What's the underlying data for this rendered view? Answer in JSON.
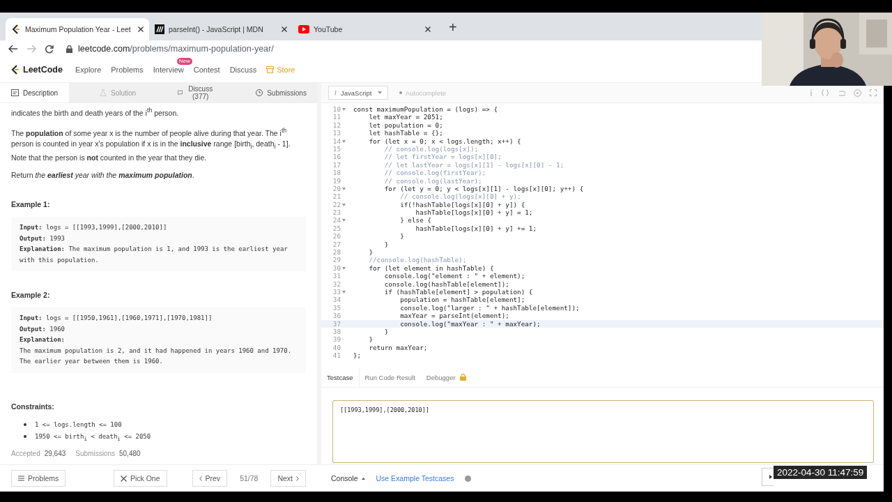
{
  "browser": {
    "tabs": [
      {
        "title": "Maximum Population Year - Leet",
        "selected": true
      },
      {
        "title": "parseInt() - JavaScript | MDN",
        "selected": false
      },
      {
        "title": "YouTube",
        "selected": false
      }
    ],
    "new_tab": "+",
    "url_host": "leetcode.com",
    "url_path": "/problems/maximum-population-year/"
  },
  "nav": {
    "brand": "LeetCode",
    "items": [
      {
        "label": "Explore"
      },
      {
        "label": "Problems"
      },
      {
        "label": "Interview",
        "badge": "New"
      },
      {
        "label": "Contest"
      },
      {
        "label": "Discuss"
      },
      {
        "label": "Store",
        "kind": "store"
      }
    ]
  },
  "left_tabs": [
    {
      "label": "Description",
      "selected": true,
      "disabled": false
    },
    {
      "label": "Solution",
      "selected": false,
      "disabled": true
    },
    {
      "label": "Discuss (377)",
      "selected": false,
      "disabled": false
    },
    {
      "label": "Submissions",
      "selected": false,
      "disabled": false
    }
  ],
  "description": [
    "indicates the birth and death years of the i$^{th}$ person.",
    "The **population** of some year x is the number of people alive during that year. The i$^{th}$ person is counted in year x's population if x is in the **inclusive** range [birth$_{i}$, death$_{i}$ - 1]. Note that the person is **not** counted in the year that they die.",
    "Return *the* **earliest** *year with the* **maximum population**."
  ],
  "examples": [
    {
      "title": "Example 1:",
      "lines": [
        "**Input:** logs = [[1993,1999],[2000,2010]]",
        "**Output:** 1993",
        "**Explanation:** The maximum population is 1, and 1993 is the earliest year with this population."
      ]
    },
    {
      "title": "Example 2:",
      "lines": [
        "**Input:** logs = [[1950,1961],[1960,1971],[1970,1981]]",
        "**Output:** 1960",
        "**Explanation:**",
        "The maximum population is 2, and it had happened in years 1960 and 1970.",
        "The earlier year between them is 1960."
      ]
    }
  ],
  "constraints": {
    "title": "Constraints:",
    "items": [
      "1 <= logs.length <= 100",
      "1950 <= birth$_{i}$ < death$_{i}$ <= 2050"
    ]
  },
  "stats": [
    {
      "label": "Accepted",
      "value": "29,643"
    },
    {
      "label": "Submissions",
      "value": "50,480"
    }
  ],
  "editor": {
    "language": "JavaScript",
    "autocomplete": "Autocomplete",
    "lines": [
      {
        "num": "10",
        "fold": true,
        "kind": "code",
        "highlighted": false,
        "text": "const maximumPopulation = (logs) => {"
      },
      {
        "num": "11",
        "fold": false,
        "kind": "code",
        "highlighted": false,
        "text": "    let maxYear = 2051;"
      },
      {
        "num": "12",
        "fold": false,
        "kind": "code",
        "highlighted": false,
        "text": "    let population = 0;"
      },
      {
        "num": "13",
        "fold": false,
        "kind": "code",
        "highlighted": false,
        "text": "    let hashTable = {};"
      },
      {
        "num": "14",
        "fold": true,
        "kind": "code",
        "highlighted": false,
        "text": "    for (let x = 0; x < logs.length; x++) {"
      },
      {
        "num": "15",
        "fold": false,
        "kind": "comment",
        "highlighted": false,
        "text": "        // console.log(logs[x]);"
      },
      {
        "num": "16",
        "fold": false,
        "kind": "comment",
        "highlighted": false,
        "text": "        // let firstYear = logs[x][0];"
      },
      {
        "num": "17",
        "fold": false,
        "kind": "comment",
        "highlighted": false,
        "text": "        // let lastYear = logs[x][1] - logs[x][0] - 1;"
      },
      {
        "num": "18",
        "fold": false,
        "kind": "comment",
        "highlighted": false,
        "text": "        // console.log(firstYear);"
      },
      {
        "num": "19",
        "fold": false,
        "kind": "comment",
        "highlighted": false,
        "text": "        // console.log(lastYear);"
      },
      {
        "num": "20",
        "fold": true,
        "kind": "code",
        "highlighted": false,
        "text": "        for (let y = 0; y < logs[x][1] - logs[x][0]; y++) {"
      },
      {
        "num": "21",
        "fold": false,
        "kind": "comment",
        "highlighted": false,
        "text": "            // console.log(logs[x][0] + y);"
      },
      {
        "num": "22",
        "fold": true,
        "kind": "code",
        "highlighted": false,
        "text": "            if(!hashTable[logs[x][0] + y]) {"
      },
      {
        "num": "23",
        "fold": false,
        "kind": "code",
        "highlighted": false,
        "text": "                hashTable[logs[x][0] + y] = 1;"
      },
      {
        "num": "24",
        "fold": true,
        "kind": "code",
        "highlighted": false,
        "text": "            } else {"
      },
      {
        "num": "25",
        "fold": false,
        "kind": "code",
        "highlighted": false,
        "text": "                hashTable[logs[x][0] + y] += 1;"
      },
      {
        "num": "26",
        "fold": false,
        "kind": "code",
        "highlighted": false,
        "text": "            }"
      },
      {
        "num": "27",
        "fold": false,
        "kind": "code",
        "highlighted": false,
        "text": "        }"
      },
      {
        "num": "28",
        "fold": false,
        "kind": "code",
        "highlighted": false,
        "text": "    }"
      },
      {
        "num": "29",
        "fold": false,
        "kind": "comment",
        "highlighted": false,
        "text": "    //console.log(hashTable);"
      },
      {
        "num": "30",
        "fold": true,
        "kind": "code",
        "highlighted": false,
        "text": "    for (let element in hashTable) {"
      },
      {
        "num": "31",
        "fold": false,
        "kind": "code",
        "highlighted": false,
        "text": "        console.log(\"element : \" + element);"
      },
      {
        "num": "32",
        "fold": false,
        "kind": "code",
        "highlighted": false,
        "text": "        console.log(hashTable[element]);"
      },
      {
        "num": "33",
        "fold": true,
        "kind": "code",
        "highlighted": false,
        "text": "        if (hashTable[element] > population) {"
      },
      {
        "num": "34",
        "fold": false,
        "kind": "code",
        "highlighted": false,
        "text": "            population = hashTable[element];"
      },
      {
        "num": "35",
        "fold": false,
        "kind": "code",
        "highlighted": false,
        "text": "            console.log(\"larger : \" + hashTable[element]);"
      },
      {
        "num": "36",
        "fold": false,
        "kind": "code",
        "highlighted": false,
        "text": "            maxYear = parseInt(element);"
      },
      {
        "num": "37",
        "fold": false,
        "kind": "code",
        "highlighted": true,
        "text": "            console.log(\"maxYear : \" + maxYear);"
      },
      {
        "num": "38",
        "fold": false,
        "kind": "code",
        "highlighted": false,
        "text": "        }"
      },
      {
        "num": "39",
        "fold": false,
        "kind": "code",
        "highlighted": false,
        "text": "    }"
      },
      {
        "num": "40",
        "fold": false,
        "kind": "code",
        "highlighted": false,
        "text": "    return maxYear;"
      },
      {
        "num": "41",
        "fold": false,
        "kind": "code",
        "highlighted": false,
        "text": "};"
      }
    ]
  },
  "console_tabs": [
    {
      "label": "Testcase",
      "selected": true,
      "locked": false
    },
    {
      "label": "Run Code Result",
      "selected": false,
      "locked": false
    },
    {
      "label": "Debugger",
      "selected": false,
      "locked": true
    }
  ],
  "testcase": {
    "value": "[[1993,1999],[2000,2010]]"
  },
  "footer": {
    "problems": "Problems",
    "pick_one": "Pick One",
    "prev": "Prev",
    "position": "51/78",
    "next": "Next",
    "console": "Console",
    "use_example": "Use Example Testcases"
  },
  "webcam": {
    "kind": "picture"
  },
  "timestamp": "2022-04-30 11:47:59"
}
